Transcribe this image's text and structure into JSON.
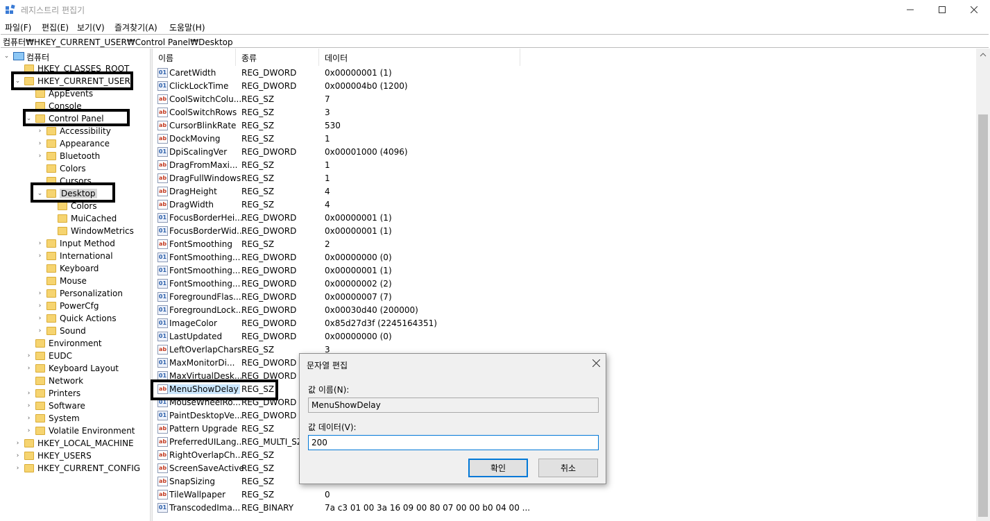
{
  "window": {
    "title": "레지스트리 편집기"
  },
  "menu": [
    "파일(F)",
    "편집(E)",
    "보기(V)",
    "즐겨찾기(A)",
    "도움말(H)"
  ],
  "address": "컴퓨터₩HKEY_CURRENT_USER₩Control Panel₩Desktop",
  "tree": [
    {
      "label": "컴퓨터",
      "level": 0,
      "expanded": true,
      "icon": "computer-icon"
    },
    {
      "label": "HKEY_CLASSES_ROOT",
      "level": 1,
      "expanded": false,
      "noarrow": true
    },
    {
      "label": "HKEY_CURRENT_USER",
      "level": 1,
      "expanded": true
    },
    {
      "label": "AppEvents",
      "level": 2,
      "expanded": false,
      "noarrow": true
    },
    {
      "label": "Console",
      "level": 2,
      "expanded": false,
      "noarrow": true
    },
    {
      "label": "Control Panel",
      "level": 2,
      "expanded": true
    },
    {
      "label": "Accessibility",
      "level": 3,
      "expanded": false
    },
    {
      "label": "Appearance",
      "level": 3,
      "expanded": false
    },
    {
      "label": "Bluetooth",
      "level": 3,
      "expanded": false
    },
    {
      "label": "Colors",
      "level": 3,
      "expanded": false,
      "noarrow": true
    },
    {
      "label": "Cursors",
      "level": 3,
      "expanded": false,
      "noarrow": true
    },
    {
      "label": "Desktop",
      "level": 3,
      "expanded": true,
      "selected": true
    },
    {
      "label": "Colors",
      "level": 4,
      "noarrow": true
    },
    {
      "label": "MuiCached",
      "level": 4,
      "noarrow": true
    },
    {
      "label": "WindowMetrics",
      "level": 4,
      "noarrow": true
    },
    {
      "label": "Input Method",
      "level": 3,
      "expanded": false
    },
    {
      "label": "International",
      "level": 3,
      "expanded": false
    },
    {
      "label": "Keyboard",
      "level": 3,
      "noarrow": true
    },
    {
      "label": "Mouse",
      "level": 3,
      "noarrow": true
    },
    {
      "label": "Personalization",
      "level": 3,
      "expanded": false
    },
    {
      "label": "PowerCfg",
      "level": 3,
      "expanded": false
    },
    {
      "label": "Quick Actions",
      "level": 3,
      "expanded": false
    },
    {
      "label": "Sound",
      "level": 3,
      "expanded": false
    },
    {
      "label": "Environment",
      "level": 2,
      "noarrow": true
    },
    {
      "label": "EUDC",
      "level": 2,
      "expanded": false
    },
    {
      "label": "Keyboard Layout",
      "level": 2,
      "expanded": false
    },
    {
      "label": "Network",
      "level": 2,
      "noarrow": true
    },
    {
      "label": "Printers",
      "level": 2,
      "expanded": false
    },
    {
      "label": "Software",
      "level": 2,
      "expanded": false
    },
    {
      "label": "System",
      "level": 2,
      "expanded": false
    },
    {
      "label": "Volatile Environment",
      "level": 2,
      "expanded": false
    },
    {
      "label": "HKEY_LOCAL_MACHINE",
      "level": 1,
      "expanded": false
    },
    {
      "label": "HKEY_USERS",
      "level": 1,
      "expanded": false
    },
    {
      "label": "HKEY_CURRENT_CONFIG",
      "level": 1,
      "expanded": false
    }
  ],
  "columns": [
    "이름",
    "종류",
    "데이터"
  ],
  "values": [
    {
      "name": "CaretWidth",
      "type": "REG_DWORD",
      "data": "0x00000001 (1)"
    },
    {
      "name": "ClickLockTime",
      "type": "REG_DWORD",
      "data": "0x000004b0 (1200)"
    },
    {
      "name": "CoolSwitchColu...",
      "type": "REG_SZ",
      "data": "7"
    },
    {
      "name": "CoolSwitchRows",
      "type": "REG_SZ",
      "data": "3"
    },
    {
      "name": "CursorBlinkRate",
      "type": "REG_SZ",
      "data": "530"
    },
    {
      "name": "DockMoving",
      "type": "REG_SZ",
      "data": "1"
    },
    {
      "name": "DpiScalingVer",
      "type": "REG_DWORD",
      "data": "0x00001000 (4096)"
    },
    {
      "name": "DragFromMaxi...",
      "type": "REG_SZ",
      "data": "1"
    },
    {
      "name": "DragFullWindows",
      "type": "REG_SZ",
      "data": "1"
    },
    {
      "name": "DragHeight",
      "type": "REG_SZ",
      "data": "4"
    },
    {
      "name": "DragWidth",
      "type": "REG_SZ",
      "data": "4"
    },
    {
      "name": "FocusBorderHei...",
      "type": "REG_DWORD",
      "data": "0x00000001 (1)"
    },
    {
      "name": "FocusBorderWid...",
      "type": "REG_DWORD",
      "data": "0x00000001 (1)"
    },
    {
      "name": "FontSmoothing",
      "type": "REG_SZ",
      "data": "2"
    },
    {
      "name": "FontSmoothing...",
      "type": "REG_DWORD",
      "data": "0x00000000 (0)"
    },
    {
      "name": "FontSmoothing...",
      "type": "REG_DWORD",
      "data": "0x00000001 (1)"
    },
    {
      "name": "FontSmoothing...",
      "type": "REG_DWORD",
      "data": "0x00000002 (2)"
    },
    {
      "name": "ForegroundFlas...",
      "type": "REG_DWORD",
      "data": "0x00000007 (7)"
    },
    {
      "name": "ForegroundLock...",
      "type": "REG_DWORD",
      "data": "0x00030d40 (200000)"
    },
    {
      "name": "ImageColor",
      "type": "REG_DWORD",
      "data": "0x85d27d3f (2245164351)"
    },
    {
      "name": "LastUpdated",
      "type": "REG_DWORD",
      "data": "0x00000000 (0)"
    },
    {
      "name": "LeftOverlapChars",
      "type": "REG_SZ",
      "data": "3"
    },
    {
      "name": "MaxMonitorDi...",
      "type": "REG_DWORD",
      "data": ""
    },
    {
      "name": "MaxVirtualDesk...",
      "type": "REG_DWORD",
      "data": ""
    },
    {
      "name": "MenuShowDelay",
      "type": "REG_SZ",
      "data": "",
      "selected": true
    },
    {
      "name": "MouseWheelRo...",
      "type": "REG_DWORD",
      "data": ""
    },
    {
      "name": "PaintDesktopVe...",
      "type": "REG_DWORD",
      "data": ""
    },
    {
      "name": "Pattern Upgrade",
      "type": "REG_SZ",
      "data": ""
    },
    {
      "name": "PreferredUILang...",
      "type": "REG_MULTI_SZ",
      "data": ""
    },
    {
      "name": "RightOverlapCh...",
      "type": "REG_SZ",
      "data": ""
    },
    {
      "name": "ScreenSaveActive",
      "type": "REG_SZ",
      "data": ""
    },
    {
      "name": "SnapSizing",
      "type": "REG_SZ",
      "data": ""
    },
    {
      "name": "TileWallpaper",
      "type": "REG_SZ",
      "data": "0"
    },
    {
      "name": "TranscodedIma...",
      "type": "REG_BINARY",
      "data": "7a c3 01 00 3a 16 09 00 80 07 00 00 b0 04 00 ..."
    }
  ],
  "dialog": {
    "title": "문자열 편집",
    "name_label": "값 이름(N):",
    "name_value": "MenuShowDelay",
    "data_label": "값 데이터(V):",
    "data_value": "200",
    "ok": "확인",
    "cancel": "취소"
  },
  "colors": {
    "folder": "#f6d470",
    "selection": "#cce8ff",
    "accent": "#0078d7"
  }
}
